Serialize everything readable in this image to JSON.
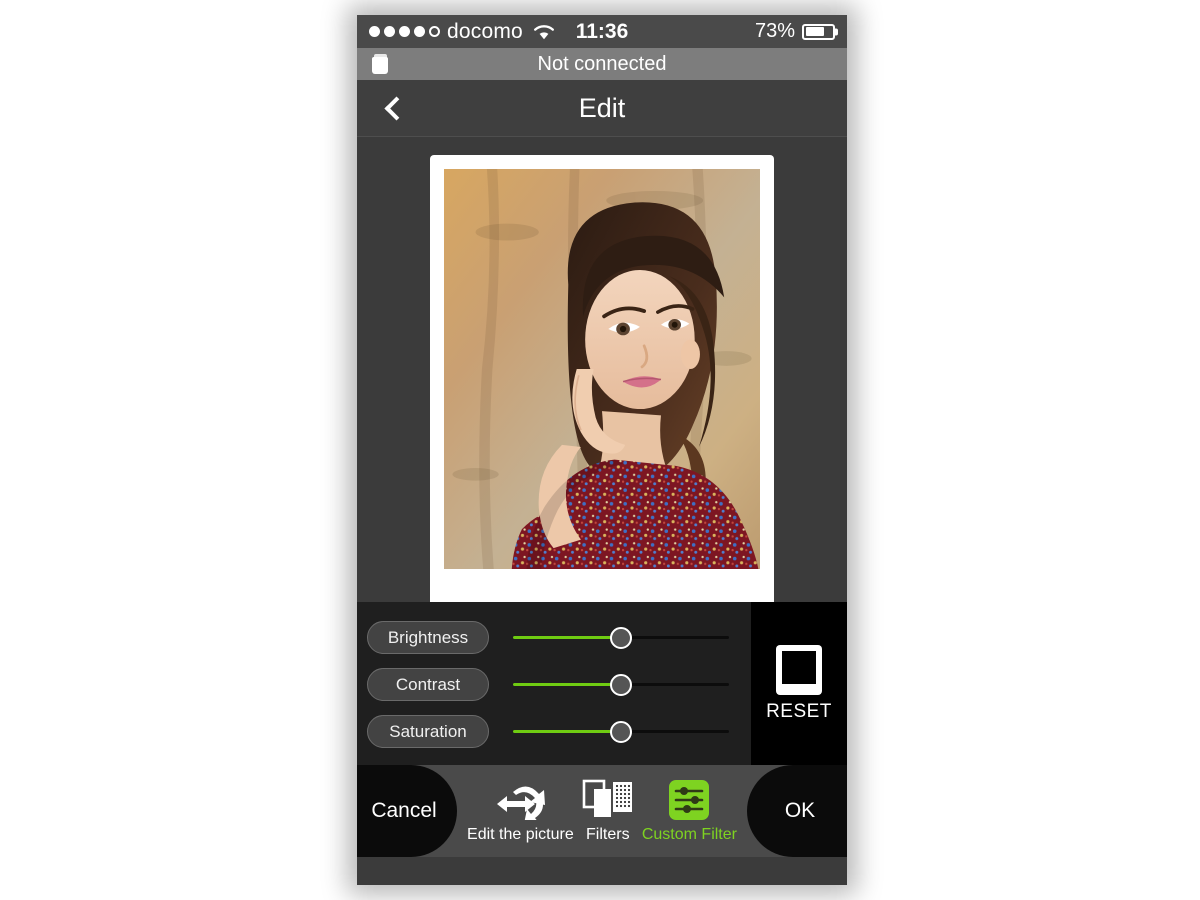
{
  "status_bar": {
    "signal_dots_filled": 4,
    "signal_dots_total": 5,
    "carrier": "docomo",
    "wifi_icon": "wifi-icon",
    "time": "11:36",
    "battery_percent": "73%",
    "battery_level": 73
  },
  "connection_bar": {
    "device_icon": "printer-icon",
    "status_text": "Not connected"
  },
  "nav_bar": {
    "back_icon": "chevron-left-icon",
    "title": "Edit"
  },
  "photo": {
    "description": "Portrait of a woman leaning against a sandstone wall wearing a dark red floral patterned dress",
    "frame_style": "polaroid"
  },
  "adjust_panel": {
    "sliders": [
      {
        "label": "Brightness",
        "value": 50,
        "fill_color": "#6fcc12"
      },
      {
        "label": "Contrast",
        "value": 50,
        "fill_color": "#6fcc12"
      },
      {
        "label": "Saturation",
        "value": 50,
        "fill_color": "#6fcc12"
      }
    ],
    "reset": {
      "icon": "polaroid-frame-icon",
      "label": "RESET"
    }
  },
  "toolbar": {
    "cancel_label": "Cancel",
    "ok_label": "OK",
    "tools": [
      {
        "label": "Edit the picture",
        "icon": "transform-arrows-icon",
        "active": false
      },
      {
        "label": "Filters",
        "icon": "filters-frames-icon",
        "active": false
      },
      {
        "label": "Custom Filter",
        "icon": "sliders-icon",
        "active": true
      }
    ]
  },
  "colors": {
    "accent_green": "#7ed321",
    "slider_green": "#6fcc12",
    "panel_dark": "#1f1f1f",
    "toolbar_gray": "#4a4a4a"
  }
}
